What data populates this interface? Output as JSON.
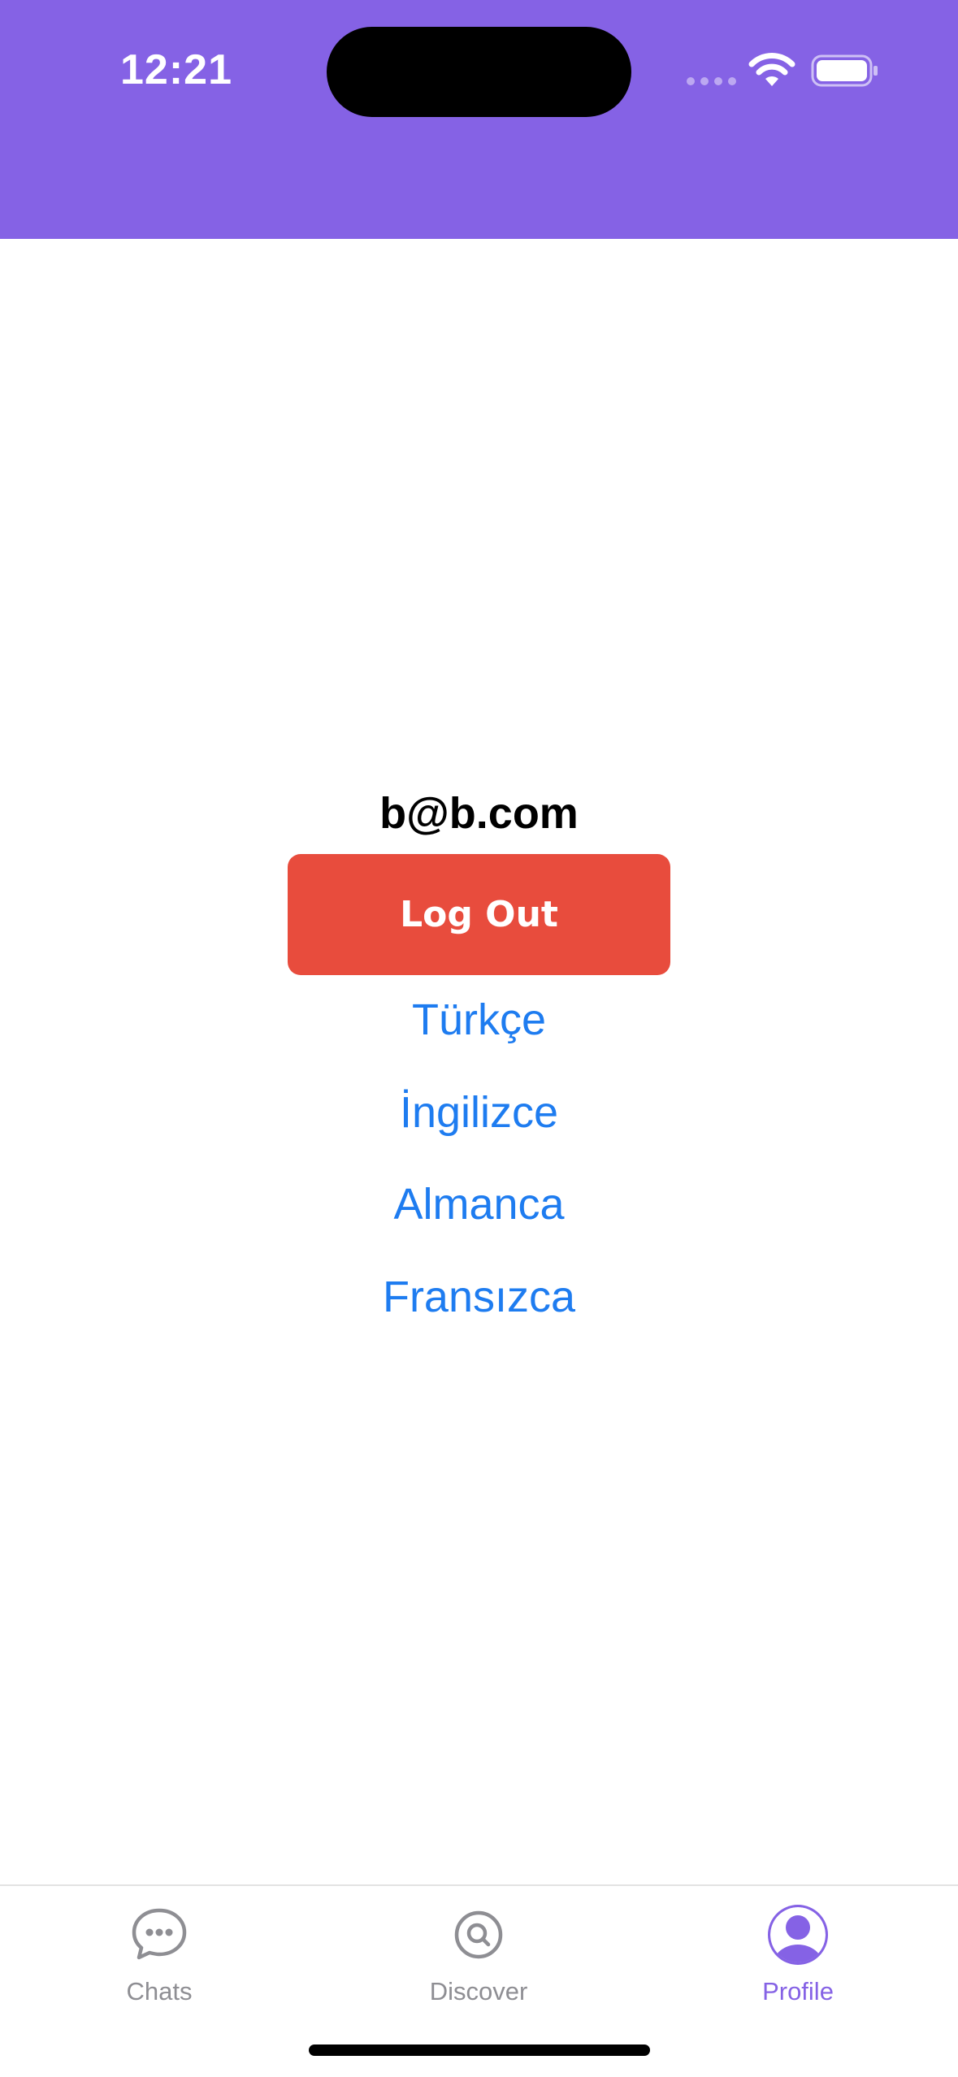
{
  "status_bar": {
    "time": "12:21"
  },
  "colors": {
    "header": "#8562E5",
    "logout_button": "#E84C3D",
    "link": "#1E7CF0",
    "tab_active": "#8562E5",
    "tab_inactive": "#8e8e93"
  },
  "profile": {
    "email": "b@b.com",
    "logout_label": "Log Out"
  },
  "languages": {
    "turkish": "Türkçe",
    "english": "İngilizce",
    "german": "Almanca",
    "french": "Fransızca"
  },
  "tabbar": {
    "chats_label": "Chats",
    "chats_icon": "chat-bubble-icon",
    "discover_label": "Discover",
    "discover_icon": "search-circle-icon",
    "profile_label": "Profile",
    "profile_icon": "person-circle-icon",
    "active": "Profile"
  }
}
